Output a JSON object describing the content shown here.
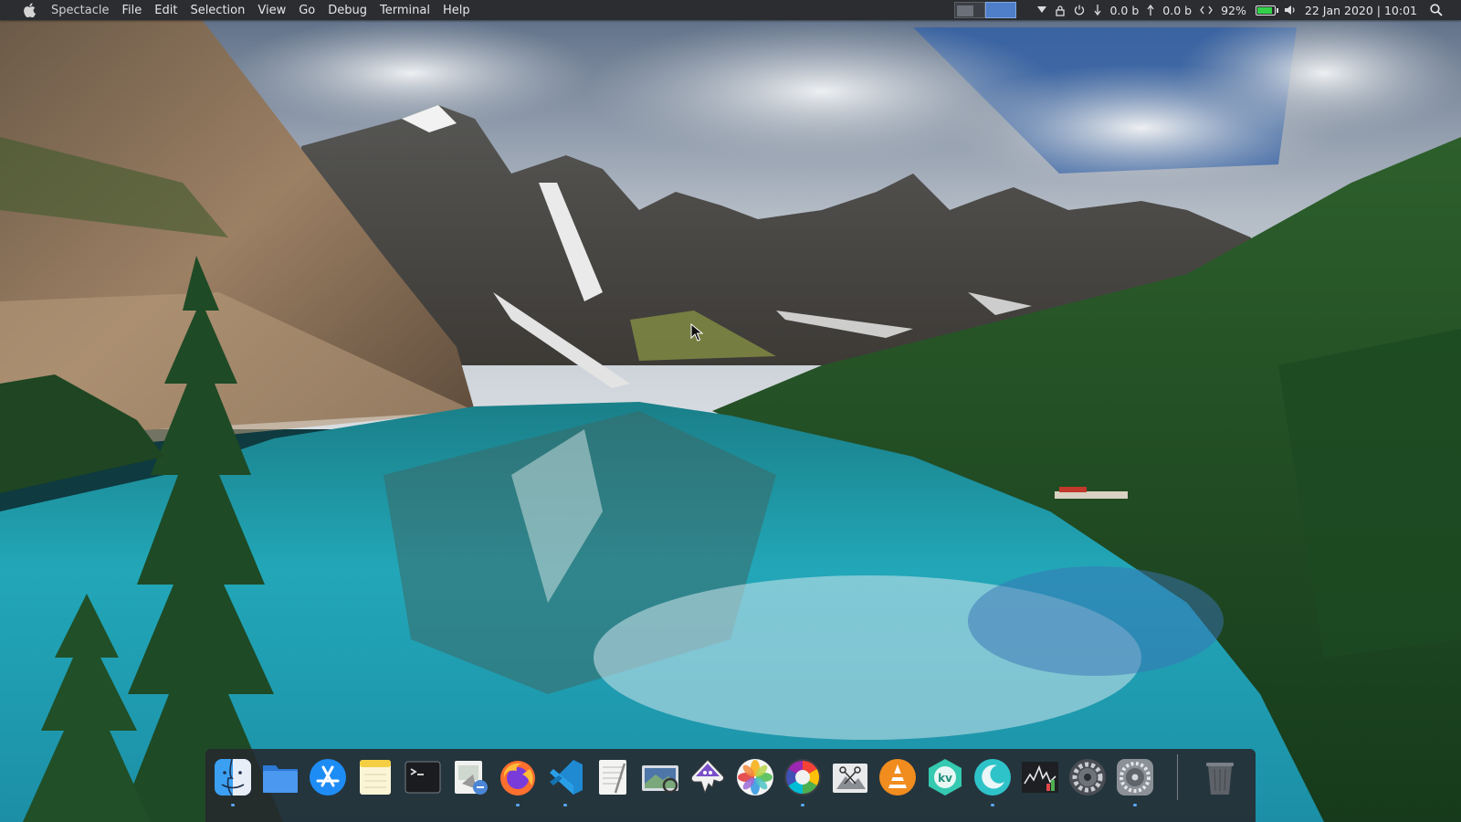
{
  "menubar": {
    "apple_icon": "apple-logo-icon",
    "app_name": "Spectacle",
    "menus": [
      "File",
      "Edit",
      "Selection",
      "View",
      "Go",
      "Debug",
      "Terminal",
      "Help"
    ],
    "tray": {
      "net_down": "0.0 b",
      "net_up": "0.0 b",
      "battery_percent": "92%",
      "battery_level": 0.92,
      "datetime": "22 Jan 2020 | 10:01",
      "icons": [
        "pager-icon",
        "dropdown-icon",
        "lock-icon",
        "power-icon",
        "arrow-down-icon",
        "arrow-up-icon",
        "network-icon",
        "battery-icon",
        "volume-icon",
        "search-icon"
      ]
    }
  },
  "dock": {
    "apps": [
      {
        "name": "finder-icon",
        "running": true
      },
      {
        "name": "folder-icon",
        "running": false
      },
      {
        "name": "app-store-icon",
        "running": false
      },
      {
        "name": "notes-icon",
        "running": false
      },
      {
        "name": "terminal-icon",
        "running": false
      },
      {
        "name": "preview-icon",
        "running": false
      },
      {
        "name": "firefox-icon",
        "running": true
      },
      {
        "name": "vscode-icon",
        "running": true
      },
      {
        "name": "textedit-icon",
        "running": false
      },
      {
        "name": "image-viewer-icon",
        "running": false
      },
      {
        "name": "inkscape-icon",
        "running": false
      },
      {
        "name": "photos-icon",
        "running": false
      },
      {
        "name": "color-wheel-icon",
        "running": true
      },
      {
        "name": "screenshot-tool-icon",
        "running": false
      },
      {
        "name": "vlc-icon",
        "running": false
      },
      {
        "name": "kvantum-icon",
        "running": false
      },
      {
        "name": "night-mode-icon",
        "running": true
      },
      {
        "name": "system-monitor-icon",
        "running": false
      },
      {
        "name": "settings-gear-icon",
        "running": false
      },
      {
        "name": "system-preferences-icon",
        "running": true
      }
    ],
    "trash": {
      "name": "trash-icon"
    }
  },
  "colors": {
    "menubar_bg": "#2b2d31",
    "dock_bg": "#26282e",
    "lake": "#1fa3b3",
    "forest": "#1f4a24",
    "sky": "#9fb2c7",
    "running_indicator": "#5aa9ff"
  }
}
